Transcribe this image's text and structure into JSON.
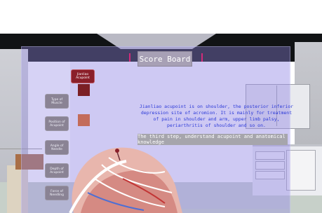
{
  "board": {
    "title": "Score Board"
  },
  "steps": {
    "active_label": "Jianliao Acupoint"
  },
  "side_buttons": [
    {
      "label": "Type of Muscle"
    },
    {
      "label": "Position of Acupoint"
    },
    {
      "label": "Angle of Needle"
    },
    {
      "label": "Depth of Acupoint"
    },
    {
      "label": "Force of Needling"
    }
  ],
  "description": {
    "text": "Jianliao acupoint is on shoulder, the posterior inferior depression site of acromion. It is mainly for treatment of pain in shoulder and arm, upper limb palsy, periarthritis of shoulder and so on."
  },
  "step_bar": {
    "text": "The third step, understand acupoint and anatomical knowledge"
  },
  "icons": {
    "sidebar_thumb_1": "muscle-thumbnail-icon",
    "sidebar_thumb_2": "skeleton-thumbnail-icon",
    "model": "shoulder-anatomy-model"
  },
  "colors": {
    "active_button": "#8a1f2a",
    "description_text": "#2b39d8",
    "board_panel": "#9288e4"
  }
}
